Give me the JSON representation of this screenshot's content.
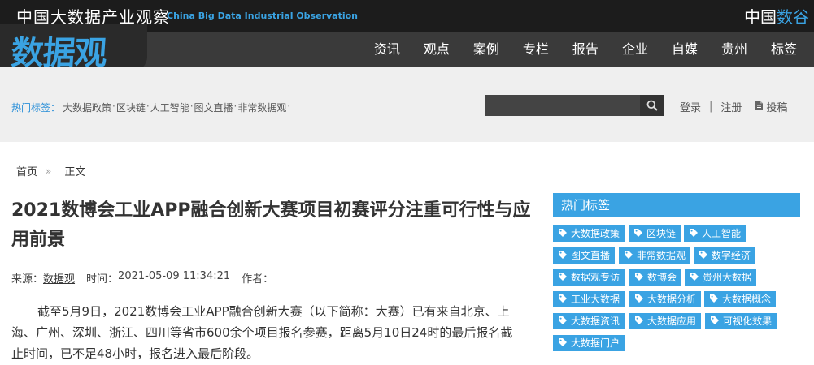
{
  "header": {
    "site_title": "中国大数据产业观察",
    "site_subtitle": "China Big Data Industrial Observation",
    "brand_right_a": "中国",
    "brand_right_b": "数谷",
    "logo": "数据观",
    "nav": [
      "资讯",
      "观点",
      "案例",
      "专栏",
      "报告",
      "企业",
      "自媒",
      "贵州",
      "标签"
    ]
  },
  "tagbar": {
    "hot_label": "热门标签：",
    "hot_tags": [
      "大数据政策",
      "区块链",
      "人工智能",
      "图文直播",
      "非常数据观"
    ],
    "search_placeholder": "",
    "login": "登录",
    "divider": "|",
    "register": "注册",
    "submit": "投稿"
  },
  "breadcrumb": {
    "home": "首页",
    "chev": "»",
    "current": "正文"
  },
  "article": {
    "title": "2021数博会工业APP融合创新大赛项目初赛评分注重可行性与应用前景",
    "source_label": "来源：",
    "source": "数据观",
    "time_label": "时间：",
    "time": "2021-05-09 11:34:21",
    "author_label": "作者：",
    "body": "截至5月9日，2021数博会工业APP融合创新大赛（以下简称：大赛）已有来自北京、上海、广州、深圳、浙江、四川等省市600余个项目报名参赛，距离5月10日24时的最后报名截止时间，已不足48小时，报名进入最后阶段。"
  },
  "sidebar": {
    "title": "热门标签",
    "tags": [
      "大数据政策",
      "区块链",
      "人工智能",
      "图文直播",
      "非常数据观",
      "数字经济",
      "数据观专访",
      "数博会",
      "贵州大数据",
      "工业大数据",
      "大数据分析",
      "大数据概念",
      "大数据资讯",
      "大数据应用",
      "可视化效果",
      "大数据门户"
    ]
  },
  "colors": {
    "accent": "#3aa3e3",
    "topbar": "#1c1c1c",
    "navbar": "#3a3a3a",
    "tagbar": "#efefef"
  }
}
